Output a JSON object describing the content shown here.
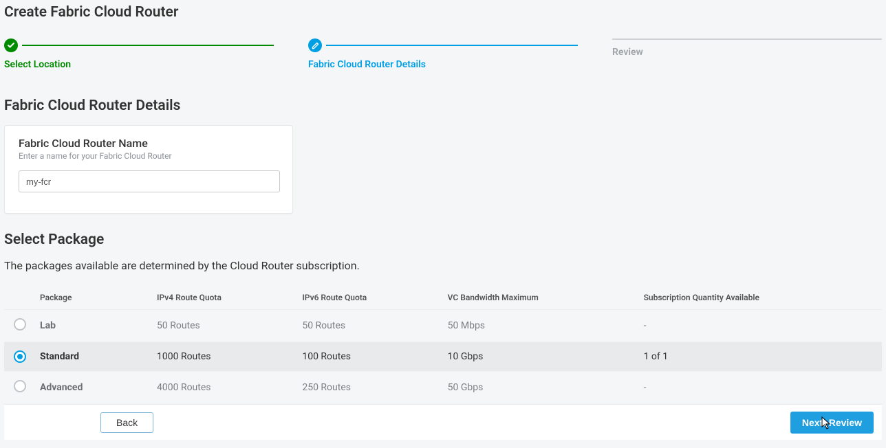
{
  "pageTitle": "Create Fabric Cloud Router",
  "stepper": {
    "steps": [
      {
        "label": "Select Location",
        "state": "completed"
      },
      {
        "label": "Fabric Cloud Router Details",
        "state": "current"
      },
      {
        "label": "Review",
        "state": "upcoming"
      }
    ]
  },
  "detailsSection": {
    "title": "Fabric Cloud Router Details",
    "nameField": {
      "label": "Fabric Cloud Router Name",
      "help": "Enter a name for your Fabric Cloud Router",
      "value": "my-fcr"
    }
  },
  "packageSection": {
    "title": "Select Package",
    "description": "The packages available are determined by the Cloud Router subscription.",
    "columns": {
      "package": "Package",
      "ipv4": "IPv4 Route Quota",
      "ipv6": "IPv6 Route Quota",
      "vcMax": "VC Bandwidth Maximum",
      "subQty": "Subscription Quantity Available"
    },
    "rows": [
      {
        "name": "Lab",
        "ipv4": "50 Routes",
        "ipv6": "50 Routes",
        "vcMax": "50 Mbps",
        "subQty": "-",
        "selected": false
      },
      {
        "name": "Standard",
        "ipv4": "1000 Routes",
        "ipv6": "100 Routes",
        "vcMax": "10 Gbps",
        "subQty": "1 of 1",
        "selected": true
      },
      {
        "name": "Advanced",
        "ipv4": "4000 Routes",
        "ipv6": "250 Routes",
        "vcMax": "50 Gbps",
        "subQty": "-",
        "selected": false
      }
    ]
  },
  "footer": {
    "back": "Back",
    "next": "Next: Review"
  }
}
